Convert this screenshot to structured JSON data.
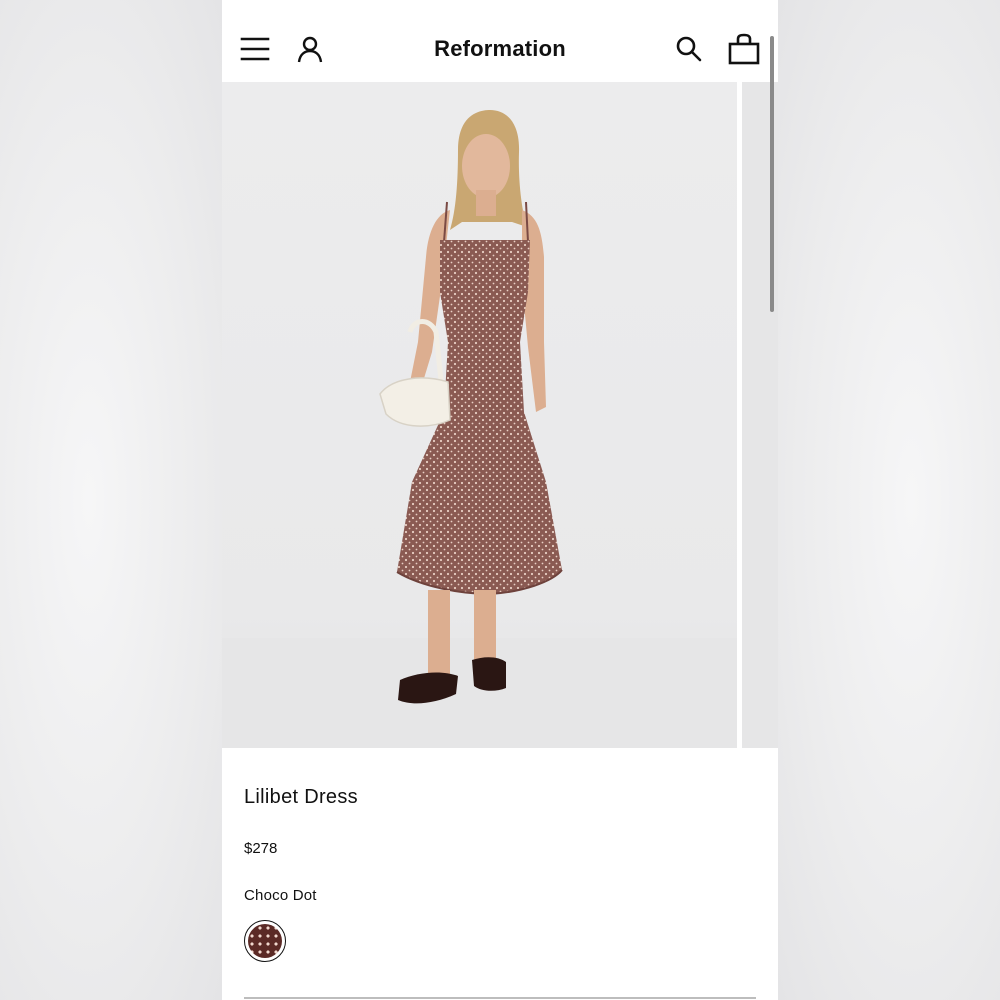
{
  "header": {
    "brand": "Reformation",
    "icons": [
      "hamburger-menu-icon",
      "account-icon",
      "search-icon",
      "shopping-bag-icon"
    ]
  },
  "product": {
    "name": "Lilibet Dress",
    "price": "$278",
    "color_name": "Choco Dot",
    "swatch_color": "#5b2a26",
    "dot_color": "#f1d9cf"
  },
  "colors": {
    "page_bg": "#ffffff",
    "photo_bg": "#e9e9ea",
    "dress": "#8a5a52",
    "text": "#111111"
  }
}
